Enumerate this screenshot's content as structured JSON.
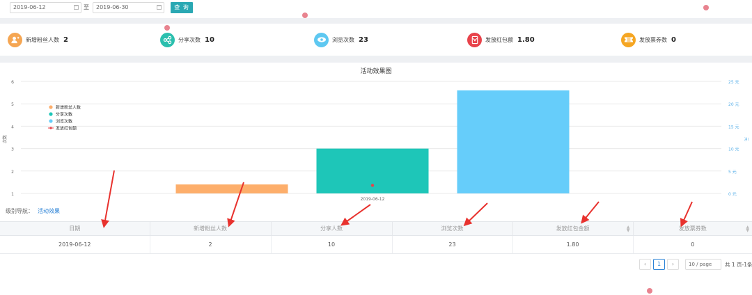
{
  "filter": {
    "start_date": "2019-06-12",
    "to_label": "至",
    "end_date": "2019-06-30",
    "query_label": "查 询"
  },
  "stats": [
    {
      "label": "新增粉丝人数",
      "value": "2",
      "color": "#f5a653",
      "icon": "user-add-icon"
    },
    {
      "label": "分享次数",
      "value": "10",
      "color": "#2bbfae",
      "icon": "share-icon"
    },
    {
      "label": "浏览次数",
      "value": "23",
      "color": "#5ec8f1",
      "icon": "eye-icon"
    },
    {
      "label": "发放红包额",
      "value": "1.80",
      "color": "#e8434b",
      "icon": "red-packet-icon"
    },
    {
      "label": "发放票券数",
      "value": "0",
      "color": "#f5a623",
      "icon": "ticket-icon"
    }
  ],
  "chart_data": {
    "type": "bar",
    "title": "活动效果图",
    "ylabel": "次数",
    "y2label": "元",
    "categories": [
      "2019-06-12"
    ],
    "ylim": [
      1,
      6
    ],
    "y_ticks": [
      1,
      2,
      3,
      4,
      5,
      6
    ],
    "y2lim": [
      0,
      25
    ],
    "y2_ticks": [
      "0 元",
      "5 元",
      "10 元",
      "15 元",
      "20 元",
      "25 元"
    ],
    "legend_position": "top-left",
    "series": [
      {
        "name": "新增粉丝人数",
        "type": "bar",
        "values": [
          1.4
        ],
        "color": "#fdae6b"
      },
      {
        "name": "分享次数",
        "type": "bar",
        "values": [
          3.0
        ],
        "color": "#1ec6b8"
      },
      {
        "name": "浏览次数",
        "type": "bar",
        "values": [
          5.6
        ],
        "color": "#66cdfa"
      },
      {
        "name": "发放红包额",
        "type": "line",
        "values": [
          1.8
        ],
        "color": "#e8434b"
      }
    ]
  },
  "nav": {
    "label": "级别导航：",
    "link": "活动效果"
  },
  "table": {
    "columns": [
      "日期",
      "新增粉丝人数",
      "分享人数",
      "浏览次数",
      "发放红包金额",
      "发放票券数"
    ],
    "sortable": [
      false,
      false,
      false,
      false,
      true,
      true
    ],
    "rows": [
      [
        "2019-06-12",
        "2",
        "10",
        "23",
        "1.80",
        "0"
      ]
    ]
  },
  "pagination": {
    "current_page": "1",
    "page_size": "10 / page",
    "total": "共 1 页-1条"
  }
}
